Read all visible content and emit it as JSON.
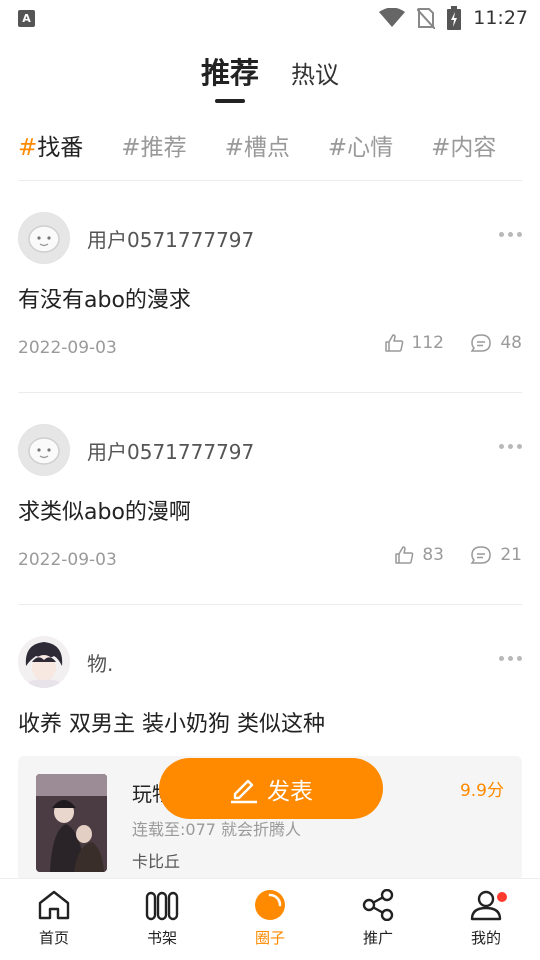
{
  "status_bar": {
    "time": "11:27",
    "left_icon_letter": "A"
  },
  "top_tabs": {
    "active": "推荐",
    "inactive": "热议"
  },
  "hashtags": [
    {
      "hash": "#",
      "label": "找番",
      "active": true
    },
    {
      "hash": "#",
      "label": "推荐",
      "active": false
    },
    {
      "hash": "#",
      "label": "槽点",
      "active": false
    },
    {
      "hash": "#",
      "label": "心情",
      "active": false
    },
    {
      "hash": "#",
      "label": "内容",
      "active": false
    }
  ],
  "posts": [
    {
      "username": "用户0571777797",
      "title": "有没有abo的漫求",
      "date": "2022-09-03",
      "likes": "112",
      "comments": "48"
    },
    {
      "username": "用户0571777797",
      "title": "求类似abo的漫啊",
      "date": "2022-09-03",
      "likes": "83",
      "comments": "21"
    },
    {
      "username": "物.",
      "title": "收养  双男主  装小奶狗  类似这种"
    }
  ],
  "book": {
    "title": "玩物",
    "score": "9.9分",
    "status": "连载至:077 就会折腾人",
    "author": "卡比丘"
  },
  "fab": {
    "label": "发表",
    "icon": "edit-icon"
  },
  "bottom_nav": [
    {
      "label": "首页",
      "icon": "home-icon"
    },
    {
      "label": "书架",
      "icon": "bookshelf-icon"
    },
    {
      "label": "圈子",
      "icon": "circle-icon",
      "active": true
    },
    {
      "label": "推广",
      "icon": "share-icon"
    },
    {
      "label": "我的",
      "icon": "user-icon",
      "badge": true
    }
  ],
  "colors": {
    "accent": "#ff8a00",
    "badge": "#ff3b30",
    "muted": "#9a9a9a"
  }
}
